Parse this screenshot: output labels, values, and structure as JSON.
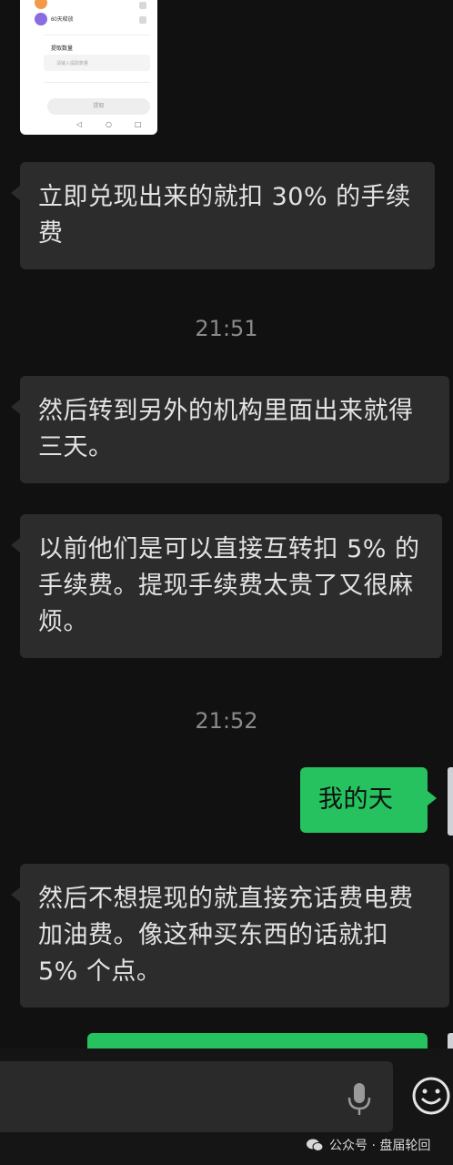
{
  "screenshot_card": {
    "rows": [
      {
        "title": "",
        "sub": "",
        "color": "#f29a4a"
      },
      {
        "title": "60天释放",
        "sub": "",
        "color": "#8b6be0"
      }
    ],
    "amount_label": "提取数量",
    "amount_placeholder": "请输入提取数量",
    "small_note": "",
    "button_label": "提取",
    "nav": [
      "◁",
      "○",
      "□"
    ]
  },
  "messages": [
    {
      "type": "in",
      "text": "立即兑现出来的就扣 30% 的手续费"
    },
    {
      "type": "time",
      "text": "21:51"
    },
    {
      "type": "in",
      "text": "然后转到另外的机构里面出来就得三天。"
    },
    {
      "type": "in",
      "text": "以前他们是可以直接互转扣 5% 的手续费。提现手续费太贵了又很麻烦。"
    },
    {
      "type": "time",
      "text": "21:52"
    },
    {
      "type": "out",
      "text": "我的天"
    },
    {
      "type": "in",
      "text": "然后不想提现的就直接充话费电费加油费。像这种买东西的话就扣 5% 个点。"
    },
    {
      "type": "out",
      "text": ""
    }
  ],
  "input_bar": {
    "mic_icon": "microphone-icon",
    "emoji_icon": "emoji-smile-icon"
  },
  "footer": {
    "icon": "wechat-icon",
    "text": "公众号 · 盘届轮回"
  },
  "colors": {
    "background": "#111111",
    "incoming_bubble": "#2c2c2c",
    "outgoing_bubble": "#25c25f",
    "timestamp": "#8a8a8a"
  }
}
